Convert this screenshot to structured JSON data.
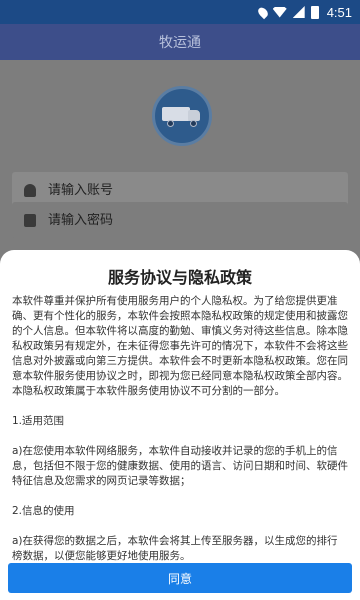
{
  "status_bar": {
    "time": "4:51"
  },
  "header": {
    "title": "牧运通"
  },
  "login": {
    "account_placeholder": "请输入账号",
    "password_placeholder": "请输入密码"
  },
  "dialog": {
    "title": "服务协议与隐私政策",
    "paragraphs": [
      "本软件尊重并保护所有使用服务用户的个人隐私权。为了给您提供更准确、更有个性化的服务，本软件会按照本隐私权政策的规定使用和披露您的个人信息。但本软件将以高度的勤勉、审慎义务对待这些信息。除本隐私权政策另有规定外，在未征得您事先许可的情况下，本软件不会将这些信息对外披露或向第三方提供。本软件会不时更新本隐私权政策。您在同意本软件服务使用协议之时，即视为您已经同意本隐私权政策全部内容。本隐私权政策属于本软件服务使用协议不可分割的一部分。",
      "1.适用范围",
      "a)在您使用本软件网络服务，本软件自动接收并记录的您的手机上的信息，包括但不限于您的健康数据、使用的语言、访问日期和时间、软硬件特征信息及您需求的网页记录等数据；",
      "2.信息的使用",
      "a)在获得您的数据之后，本软件会将其上传至服务器，以生成您的排行榜数据，以便您能够更好地使用服务。"
    ],
    "agree_label": "同意"
  }
}
